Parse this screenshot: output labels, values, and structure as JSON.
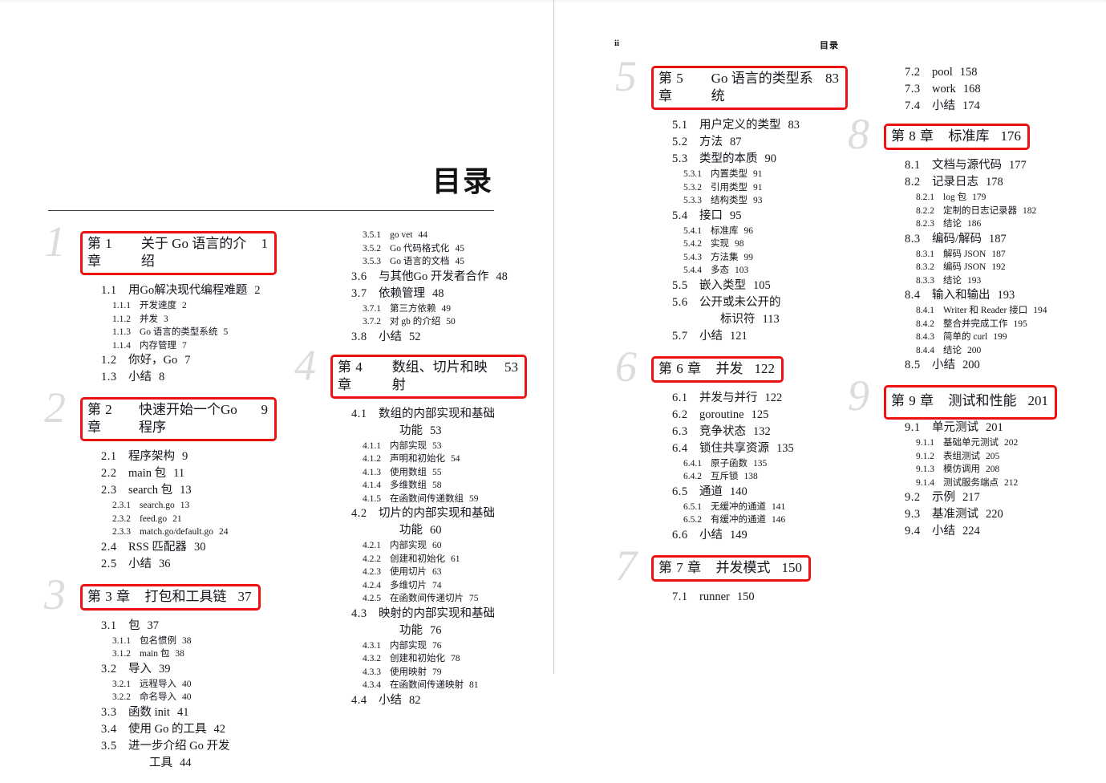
{
  "document": {
    "title": "目录",
    "running_head": {
      "folio": "ii",
      "label": "目录"
    }
  },
  "left_page": {
    "column1": {
      "chapters": [
        {
          "ghost": "1",
          "number": "第 1 章",
          "title": "关于 Go 语言的介绍",
          "page": "1",
          "entries": [
            {
              "level": 1,
              "num": "1.1",
              "text": "用Go解决现代编程难题",
              "page": "2"
            },
            {
              "level": 2,
              "num": "1.1.1",
              "text": "开发速度",
              "page": "2"
            },
            {
              "level": 2,
              "num": "1.1.2",
              "text": "并发",
              "page": "3"
            },
            {
              "level": 2,
              "num": "1.1.3",
              "text": "Go 语言的类型系统",
              "page": "5"
            },
            {
              "level": 2,
              "num": "1.1.4",
              "text": "内存管理",
              "page": "7"
            },
            {
              "level": 1,
              "num": "1.2",
              "text": "你好，Go",
              "page": "7"
            },
            {
              "level": 1,
              "num": "1.3",
              "text": "小结",
              "page": "8"
            }
          ]
        },
        {
          "ghost": "2",
          "number": "第 2 章",
          "title": "快速开始一个Go 程序",
          "page": "9",
          "entries": [
            {
              "level": 1,
              "num": "2.1",
              "text": "程序架构",
              "page": "9"
            },
            {
              "level": 1,
              "num": "2.2",
              "text": "main 包",
              "page": "11"
            },
            {
              "level": 1,
              "num": "2.3",
              "text": "search 包",
              "page": "13"
            },
            {
              "level": 2,
              "num": "2.3.1",
              "text": "search.go",
              "page": "13"
            },
            {
              "level": 2,
              "num": "2.3.2",
              "text": "feed.go",
              "page": "21"
            },
            {
              "level": 2,
              "num": "2.3.3",
              "text": "match.go/default.go",
              "page": "24"
            },
            {
              "level": 1,
              "num": "2.4",
              "text": "RSS 匹配器",
              "page": "30"
            },
            {
              "level": 1,
              "num": "2.5",
              "text": "小结",
              "page": "36"
            }
          ]
        },
        {
          "ghost": "3",
          "number": "第 3 章",
          "title": "打包和工具链",
          "page": "37",
          "entries": [
            {
              "level": 1,
              "num": "3.1",
              "text": "包",
              "page": "37"
            },
            {
              "level": 2,
              "num": "3.1.1",
              "text": "包名惯例",
              "page": "38"
            },
            {
              "level": 2,
              "num": "3.1.2",
              "text": "main 包",
              "page": "38"
            },
            {
              "level": 1,
              "num": "3.2",
              "text": "导入",
              "page": "39"
            },
            {
              "level": 2,
              "num": "3.2.1",
              "text": "远程导入",
              "page": "40"
            },
            {
              "level": 2,
              "num": "3.2.2",
              "text": "命名导入",
              "page": "40"
            },
            {
              "level": 1,
              "num": "3.3",
              "text": "函数 init",
              "page": "41"
            },
            {
              "level": 1,
              "num": "3.4",
              "text": "使用 Go 的工具",
              "page": "42"
            },
            {
              "level": 1,
              "num": "3.5",
              "text": "进一步介绍 Go 开发",
              "page": ""
            },
            {
              "level": 0,
              "num": "",
              "text": "工具",
              "page": "44"
            }
          ]
        }
      ]
    },
    "column2": {
      "lead_entries": [
        {
          "level": 2,
          "num": "3.5.1",
          "text": "go vet",
          "page": "44"
        },
        {
          "level": 2,
          "num": "3.5.2",
          "text": "Go 代码格式化",
          "page": "45"
        },
        {
          "level": 2,
          "num": "3.5.3",
          "text": "Go 语言的文档",
          "page": "45"
        },
        {
          "level": 1,
          "num": "3.6",
          "text": "与其他Go 开发者合作",
          "page": "48"
        },
        {
          "level": 1,
          "num": "3.7",
          "text": "依赖管理",
          "page": "48"
        },
        {
          "level": 2,
          "num": "3.7.1",
          "text": "第三方依赖",
          "page": "49"
        },
        {
          "level": 2,
          "num": "3.7.2",
          "text": "对 gb 的介绍",
          "page": "50"
        },
        {
          "level": 1,
          "num": "3.8",
          "text": "小结",
          "page": "52"
        }
      ],
      "chapters": [
        {
          "ghost": "4",
          "number": "第 4 章",
          "title": "数组、切片和映射",
          "page": "53",
          "entries": [
            {
              "level": 1,
              "num": "4.1",
              "text": "数组的内部实现和基础",
              "page": ""
            },
            {
              "level": 0,
              "num": "",
              "text": "功能",
              "page": "53"
            },
            {
              "level": 2,
              "num": "4.1.1",
              "text": "内部实现",
              "page": "53"
            },
            {
              "level": 2,
              "num": "4.1.2",
              "text": "声明和初始化",
              "page": "54"
            },
            {
              "level": 2,
              "num": "4.1.3",
              "text": "使用数组",
              "page": "55"
            },
            {
              "level": 2,
              "num": "4.1.4",
              "text": "多维数组",
              "page": "58"
            },
            {
              "level": 2,
              "num": "4.1.5",
              "text": "在函数间传递数组",
              "page": "59"
            },
            {
              "level": 1,
              "num": "4.2",
              "text": "切片的内部实现和基础",
              "page": ""
            },
            {
              "level": 0,
              "num": "",
              "text": "功能",
              "page": "60"
            },
            {
              "level": 2,
              "num": "4.2.1",
              "text": "内部实现",
              "page": "60"
            },
            {
              "level": 2,
              "num": "4.2.2",
              "text": "创建和初始化",
              "page": "61"
            },
            {
              "level": 2,
              "num": "4.2.3",
              "text": "使用切片",
              "page": "63"
            },
            {
              "level": 2,
              "num": "4.2.4",
              "text": "多维切片",
              "page": "74"
            },
            {
              "level": 2,
              "num": "4.2.5",
              "text": "在函数间传递切片",
              "page": "75"
            },
            {
              "level": 1,
              "num": "4.3",
              "text": "映射的内部实现和基础",
              "page": ""
            },
            {
              "level": 0,
              "num": "",
              "text": "功能",
              "page": "76"
            },
            {
              "level": 2,
              "num": "4.3.1",
              "text": "内部实现",
              "page": "76"
            },
            {
              "level": 2,
              "num": "4.3.2",
              "text": "创建和初始化",
              "page": "78"
            },
            {
              "level": 2,
              "num": "4.3.3",
              "text": "使用映射",
              "page": "79"
            },
            {
              "level": 2,
              "num": "4.3.4",
              "text": "在函数间传递映射",
              "page": "81"
            },
            {
              "level": 1,
              "num": "4.4",
              "text": "小结",
              "page": "82"
            }
          ]
        }
      ]
    }
  },
  "right_page": {
    "column3": {
      "chapters": [
        {
          "ghost": "5",
          "number": "第 5 章",
          "title": "Go 语言的类型系统",
          "page": "83",
          "entries": [
            {
              "level": 1,
              "num": "5.1",
              "text": "用户定义的类型",
              "page": "83"
            },
            {
              "level": 1,
              "num": "5.2",
              "text": "方法",
              "page": "87"
            },
            {
              "level": 1,
              "num": "5.3",
              "text": "类型的本质",
              "page": "90"
            },
            {
              "level": 2,
              "num": "5.3.1",
              "text": "内置类型",
              "page": "91"
            },
            {
              "level": 2,
              "num": "5.3.2",
              "text": "引用类型",
              "page": "91"
            },
            {
              "level": 2,
              "num": "5.3.3",
              "text": "结构类型",
              "page": "93"
            },
            {
              "level": 1,
              "num": "5.4",
              "text": "接口",
              "page": "95"
            },
            {
              "level": 2,
              "num": "5.4.1",
              "text": "标准库",
              "page": "96"
            },
            {
              "level": 2,
              "num": "5.4.2",
              "text": "实现",
              "page": "98"
            },
            {
              "level": 2,
              "num": "5.4.3",
              "text": "方法集",
              "page": "99"
            },
            {
              "level": 2,
              "num": "5.4.4",
              "text": "多态",
              "page": "103"
            },
            {
              "level": 1,
              "num": "5.5",
              "text": "嵌入类型",
              "page": "105"
            },
            {
              "level": 1,
              "num": "5.6",
              "text": "公开或未公开的",
              "page": ""
            },
            {
              "level": 0,
              "num": "",
              "text": "标识符",
              "page": "113"
            },
            {
              "level": 1,
              "num": "5.7",
              "text": "小结",
              "page": "121"
            }
          ]
        },
        {
          "ghost": "6",
          "number": "第 6 章",
          "title": "并发",
          "page": "122",
          "entries": [
            {
              "level": 1,
              "num": "6.1",
              "text": "并发与并行",
              "page": "122"
            },
            {
              "level": 1,
              "num": "6.2",
              "text": "goroutine",
              "page": "125"
            },
            {
              "level": 1,
              "num": "6.3",
              "text": "竞争状态",
              "page": "132"
            },
            {
              "level": 1,
              "num": "6.4",
              "text": "锁住共享资源",
              "page": "135"
            },
            {
              "level": 2,
              "num": "6.4.1",
              "text": "原子函数",
              "page": "135"
            },
            {
              "level": 2,
              "num": "6.4.2",
              "text": "互斥锁",
              "page": "138"
            },
            {
              "level": 1,
              "num": "6.5",
              "text": "通道",
              "page": "140"
            },
            {
              "level": 2,
              "num": "6.5.1",
              "text": "无缓冲的通道",
              "page": "141"
            },
            {
              "level": 2,
              "num": "6.5.2",
              "text": "有缓冲的通道",
              "page": "146"
            },
            {
              "level": 1,
              "num": "6.6",
              "text": "小结",
              "page": "149"
            }
          ]
        },
        {
          "ghost": "7",
          "number": "第 7 章",
          "title": "并发模式",
          "page": "150",
          "entries": [
            {
              "level": 1,
              "num": "7.1",
              "text": "runner",
              "page": "150"
            }
          ]
        }
      ]
    },
    "column4": {
      "lead_entries": [
        {
          "level": 1,
          "num": "7.2",
          "text": "pool",
          "page": "158"
        },
        {
          "level": 1,
          "num": "7.3",
          "text": "work",
          "page": "168"
        },
        {
          "level": 1,
          "num": "7.4",
          "text": "小结",
          "page": "174"
        }
      ],
      "chapters": [
        {
          "ghost": "8",
          "number": "第 8 章",
          "title": "标准库",
          "page": "176",
          "entries": [
            {
              "level": 1,
              "num": "8.1",
              "text": "文档与源代码",
              "page": "177"
            },
            {
              "level": 1,
              "num": "8.2",
              "text": "记录日志",
              "page": "178"
            },
            {
              "level": 2,
              "num": "8.2.1",
              "text": "log 包",
              "page": "179"
            },
            {
              "level": 2,
              "num": "8.2.2",
              "text": "定制的日志记录器",
              "page": "182"
            },
            {
              "level": 2,
              "num": "8.2.3",
              "text": "结论",
              "page": "186"
            },
            {
              "level": 1,
              "num": "8.3",
              "text": "编码/解码",
              "page": "187"
            },
            {
              "level": 2,
              "num": "8.3.1",
              "text": "解码 JSON",
              "page": "187"
            },
            {
              "level": 2,
              "num": "8.3.2",
              "text": "编码 JSON",
              "page": "192"
            },
            {
              "level": 2,
              "num": "8.3.3",
              "text": "结论",
              "page": "193"
            },
            {
              "level": 1,
              "num": "8.4",
              "text": "输入和输出",
              "page": "193"
            },
            {
              "level": 2,
              "num": "8.4.1",
              "text": "Writer 和 Reader 接口",
              "page": "194"
            },
            {
              "level": 2,
              "num": "8.4.2",
              "text": "整合并完成工作",
              "page": "195"
            },
            {
              "level": 2,
              "num": "8.4.3",
              "text": "简单的 curl",
              "page": "199"
            },
            {
              "level": 2,
              "num": "8.4.4",
              "text": "结论",
              "page": "200"
            },
            {
              "level": 1,
              "num": "8.5",
              "text": "小结",
              "page": "200"
            }
          ]
        },
        {
          "ghost": "9",
          "number": "第 9 章",
          "title": "测试和性能",
          "page": "201",
          "tall_box": true,
          "entries": [
            {
              "level": 1,
              "num": "9.1",
              "text": "单元测试",
              "page": "201"
            },
            {
              "level": 2,
              "num": "9.1.1",
              "text": "基础单元测试",
              "page": "202"
            },
            {
              "level": 2,
              "num": "9.1.2",
              "text": "表组测试",
              "page": "205"
            },
            {
              "level": 2,
              "num": "9.1.3",
              "text": "模仿调用",
              "page": "208"
            },
            {
              "level": 2,
              "num": "9.1.4",
              "text": "测试服务端点",
              "page": "212"
            },
            {
              "level": 1,
              "num": "9.2",
              "text": "示例",
              "page": "217"
            },
            {
              "level": 1,
              "num": "9.3",
              "text": "基准测试",
              "page": "220"
            },
            {
              "level": 1,
              "num": "9.4",
              "text": "小结",
              "page": "224"
            }
          ]
        }
      ]
    }
  },
  "annotations": {
    "highlight_color": "#ee1111",
    "highlight_shape": "rounded-rectangle",
    "highlighted_items": [
      "第 1 章 关于 Go 语言的介绍 1",
      "第 2 章 快速开始一个Go 程序 9",
      "第 3 章 打包和工具链 37",
      "第 4 章 数组、切片和映射 53",
      "第 5 章 Go 语言的类型系统 83",
      "第 6 章 并发 122",
      "第 7 章 并发模式 150",
      "第 8 章 标准库 176",
      "第 9 章 测试和性能 201"
    ]
  }
}
